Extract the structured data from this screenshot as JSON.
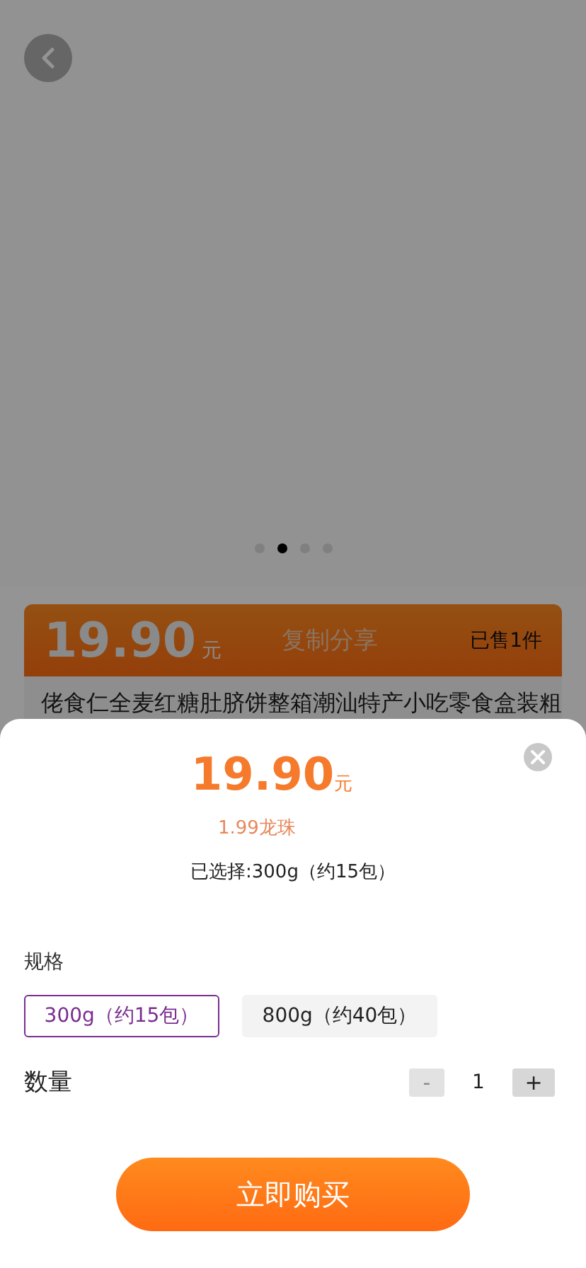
{
  "gallery": {
    "dots": [
      {
        "selected": false
      },
      {
        "selected": true
      },
      {
        "selected": false
      },
      {
        "selected": false
      }
    ]
  },
  "price_bar": {
    "price": "19.90",
    "unit": "元",
    "share": "复制分享",
    "sold": "已售1件"
  },
  "product_title": "佬食仁全麦红糖肚脐饼整箱潮汕特产小吃零食盒装粗",
  "sheet": {
    "price": "19.90",
    "unit": "元",
    "points": "1.99龙珠",
    "selected_text": "已选择:300g（约15包）",
    "spec_label": "规格",
    "specs": [
      {
        "label": "300g（约15包）",
        "selected": true
      },
      {
        "label": "800g（约40包）",
        "selected": false
      }
    ],
    "quantity_label": "数量",
    "minus": {
      "label": "-",
      "disabled": true
    },
    "quantity": "1",
    "plus": {
      "label": "+",
      "disabled": false
    },
    "buy_button": "立即购买"
  }
}
